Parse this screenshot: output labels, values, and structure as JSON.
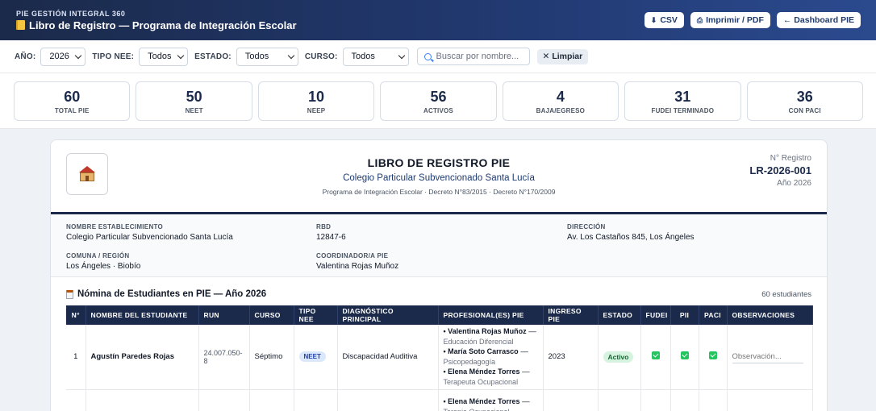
{
  "header": {
    "brand": "PIE GESTIÓN INTEGRAL 360",
    "title": "Libro de Registro — Programa de Integración Escolar",
    "actions": {
      "csv": "CSV",
      "print": "Imprimir / PDF",
      "dashboard": "← Dashboard PIE"
    }
  },
  "filters": {
    "year_label": "AÑO:",
    "year_value": "2026",
    "nee_label": "TIPO NEE:",
    "nee_value": "Todos",
    "status_label": "ESTADO:",
    "status_value": "Todos",
    "course_label": "CURSO:",
    "course_value": "Todos",
    "search_placeholder": "Buscar por nombre...",
    "clear_label": "Limpiar"
  },
  "stats": [
    {
      "value": "60",
      "label": "TOTAL PIE"
    },
    {
      "value": "50",
      "label": "NEET"
    },
    {
      "value": "10",
      "label": "NEEP"
    },
    {
      "value": "56",
      "label": "ACTIVOS"
    },
    {
      "value": "4",
      "label": "BAJA/EGRESO"
    },
    {
      "value": "31",
      "label": "FUDEI TERMINADO"
    },
    {
      "value": "36",
      "label": "CON PACI"
    }
  ],
  "document": {
    "title": "LIBRO DE REGISTRO PIE",
    "school": "Colegio Particular Subvencionado Santa Lucía",
    "decree": "Programa de Integración Escolar · Decreto N°83/2015 · Decreto N°170/2009",
    "reg_label": "N° Registro",
    "reg_number": "LR-2026-001",
    "reg_year": "Año 2026"
  },
  "info": {
    "establishment_label": "NOMBRE ESTABLECIMIENTO",
    "establishment_value": "Colegio Particular Subvencionado Santa Lucía",
    "rbd_label": "RBD",
    "rbd_value": "12847-6",
    "address_label": "DIRECCIÓN",
    "address_value": "Av. Los Castaños 845, Los Ángeles",
    "commune_label": "COMUNA / REGIÓN",
    "commune_value": "Los Ángeles · Biobío",
    "coordinator_label": "COORDINADOR/A PIE",
    "coordinator_value": "Valentina Rojas Muñoz"
  },
  "nomina": {
    "title": "Nómina de Estudiantes en PIE — Año 2026",
    "count": "60 estudiantes",
    "columns": [
      "N°",
      "NOMBRE DEL ESTUDIANTE",
      "RUN",
      "CURSO",
      "TIPO NEE",
      "DIAGNÓSTICO PRINCIPAL",
      "PROFESIONAL(ES) PIE",
      "INGRESO PIE",
      "ESTADO",
      "FUDEI",
      "PII",
      "PACI",
      "OBSERVACIONES"
    ],
    "rows": [
      {
        "n": "1",
        "name": "Agustín Paredes Rojas",
        "run": "24.007.050-8",
        "course": "Séptimo",
        "nee": "NEET",
        "diagnosis": "Discapacidad Auditiva",
        "professionals": [
          {
            "name": "• Valentina Rojas Muñoz",
            "role": "Educación Diferencial"
          },
          {
            "name": "• María Soto Carrasco",
            "role": "Psicopedagogía"
          },
          {
            "name": "• Elena Méndez Torres",
            "role": "Terapeuta Ocupacional"
          }
        ],
        "ingreso": "2023",
        "status": "Activo",
        "obs_placeholder": "Observación..."
      },
      {
        "professionals": [
          {
            "name": "• Elena Méndez Torres",
            "role": "Terapia Ocupacional"
          }
        ]
      }
    ]
  }
}
